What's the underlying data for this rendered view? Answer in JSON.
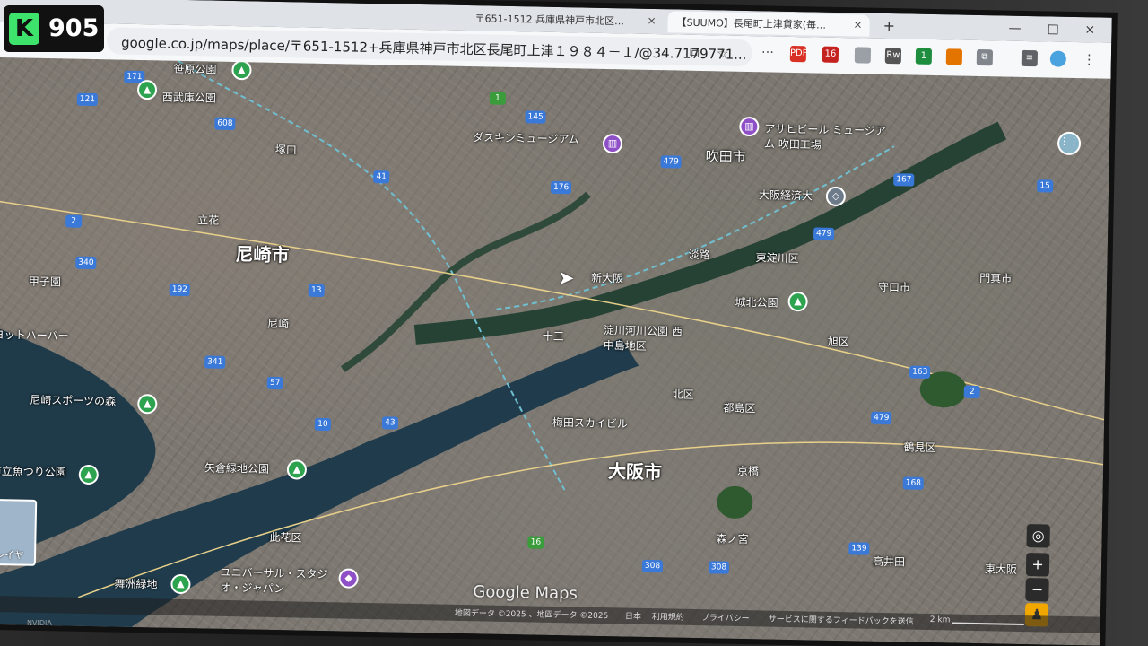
{
  "overlay": {
    "badge_logo": "K",
    "badge_count": "905"
  },
  "browser": {
    "tabs": [
      {
        "label": "〒651-1512 兵庫県神戸市北区…",
        "close": "×"
      },
      {
        "label": "【SUUMO】長尾町上津貸家(毎…",
        "close": "×"
      }
    ],
    "new_tab": "+",
    "window_controls": {
      "minimize": "—",
      "maximize": "□",
      "close": "×"
    },
    "url": "google.co.jp/maps/place/〒651-1512+兵庫県神戸市北区長尾町上津１９８４－１/@34.7179771...",
    "extensions": [
      {
        "label": "PDF",
        "color": "#d93025"
      },
      {
        "label": "16",
        "color": "#c5221f"
      },
      {
        "label": "Rw",
        "color": "#555555"
      },
      {
        "label": "1",
        "color": "#1e8e3e"
      },
      {
        "label": "",
        "color": "#e37400"
      }
    ]
  },
  "map": {
    "labels": [
      {
        "text": "笹原公園"
      },
      {
        "text": "西武庫公園"
      },
      {
        "text": "塚口"
      },
      {
        "text": "尼崎市"
      },
      {
        "text": "立花"
      },
      {
        "text": "尼崎"
      },
      {
        "text": "甲子園"
      },
      {
        "text": "ヨットハーバー"
      },
      {
        "text": "尼崎スポーツの森"
      },
      {
        "text": "市立魚つり公園"
      },
      {
        "text": "矢倉緑地公園"
      },
      {
        "text": "此花区"
      },
      {
        "text": "舞洲緑地"
      },
      {
        "text": "ユニバーサル・スタジオ・ジャパン"
      },
      {
        "text": "ダスキンミュージアム"
      },
      {
        "text": "アサヒビール ミュージアム 吹田工場"
      },
      {
        "text": "吹田市"
      },
      {
        "text": "大阪経済大"
      },
      {
        "text": "淡路"
      },
      {
        "text": "東淀川区"
      },
      {
        "text": "新大阪"
      },
      {
        "text": "十三"
      },
      {
        "text": "淀川河川公園 西中島地区"
      },
      {
        "text": "城北公園"
      },
      {
        "text": "守口市"
      },
      {
        "text": "門真市"
      },
      {
        "text": "旭区"
      },
      {
        "text": "北区"
      },
      {
        "text": "都島区"
      },
      {
        "text": "梅田スカイビル"
      },
      {
        "text": "大阪市"
      },
      {
        "text": "京橋"
      },
      {
        "text": "鶴見区"
      },
      {
        "text": "森ノ宮"
      },
      {
        "text": "高井田"
      },
      {
        "text": "東大阪"
      }
    ],
    "shields": [
      "121",
      "171",
      "608",
      "41",
      "2",
      "340",
      "192",
      "13",
      "341",
      "57",
      "43",
      "10",
      "479",
      "176",
      "145",
      "479",
      "167",
      "15",
      "2",
      "163",
      "479",
      "168",
      "139",
      "308",
      "308",
      "16",
      "1"
    ],
    "layer_label": "レイヤ",
    "logo": "Google Maps",
    "footer": {
      "attribution": "地図データ ©2025 、地図データ ©2025",
      "country": "日本",
      "terms": "利用規約",
      "privacy": "プライバシー",
      "feedback": "サービスに関するフィードバックを送信",
      "scale": "2 km"
    },
    "controls": {
      "locate": "◎",
      "zoom_in": "+",
      "zoom_out": "−",
      "pegman": "♟"
    }
  },
  "monitor_label": "NVIDIA"
}
